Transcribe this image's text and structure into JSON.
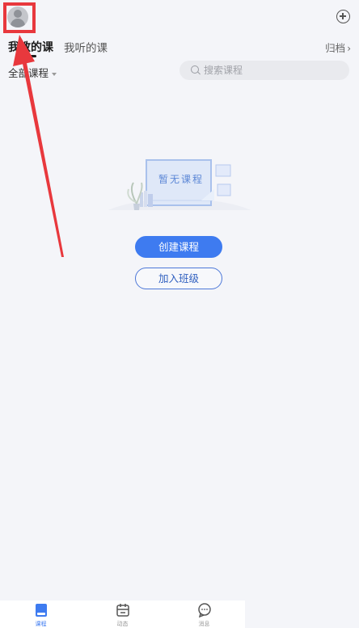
{
  "header": {
    "avatar_icon": "avatar-icon",
    "add_icon": "plus-circle-icon"
  },
  "tabs": [
    {
      "label": "我教的课",
      "active": true
    },
    {
      "label": "我听的课",
      "active": false
    }
  ],
  "archive": {
    "label": "归档",
    "chevron": "›"
  },
  "filter": {
    "label": "全部课程"
  },
  "search": {
    "placeholder": "搜索课程",
    "value": ""
  },
  "empty_state": {
    "illustration_text": "暂无课程"
  },
  "actions": {
    "create_label": "创建课程",
    "join_label": "加入班级"
  },
  "bottom_nav": [
    {
      "label": "课程",
      "icon": "book-icon",
      "active": true
    },
    {
      "label": "动态",
      "icon": "calendar-icon",
      "active": false
    },
    {
      "label": "消息",
      "icon": "chat-bubble-icon",
      "active": false
    }
  ],
  "colors": {
    "accent": "#3e7bf0",
    "annotation": "#e8383d",
    "background": "#f4f5f9"
  }
}
